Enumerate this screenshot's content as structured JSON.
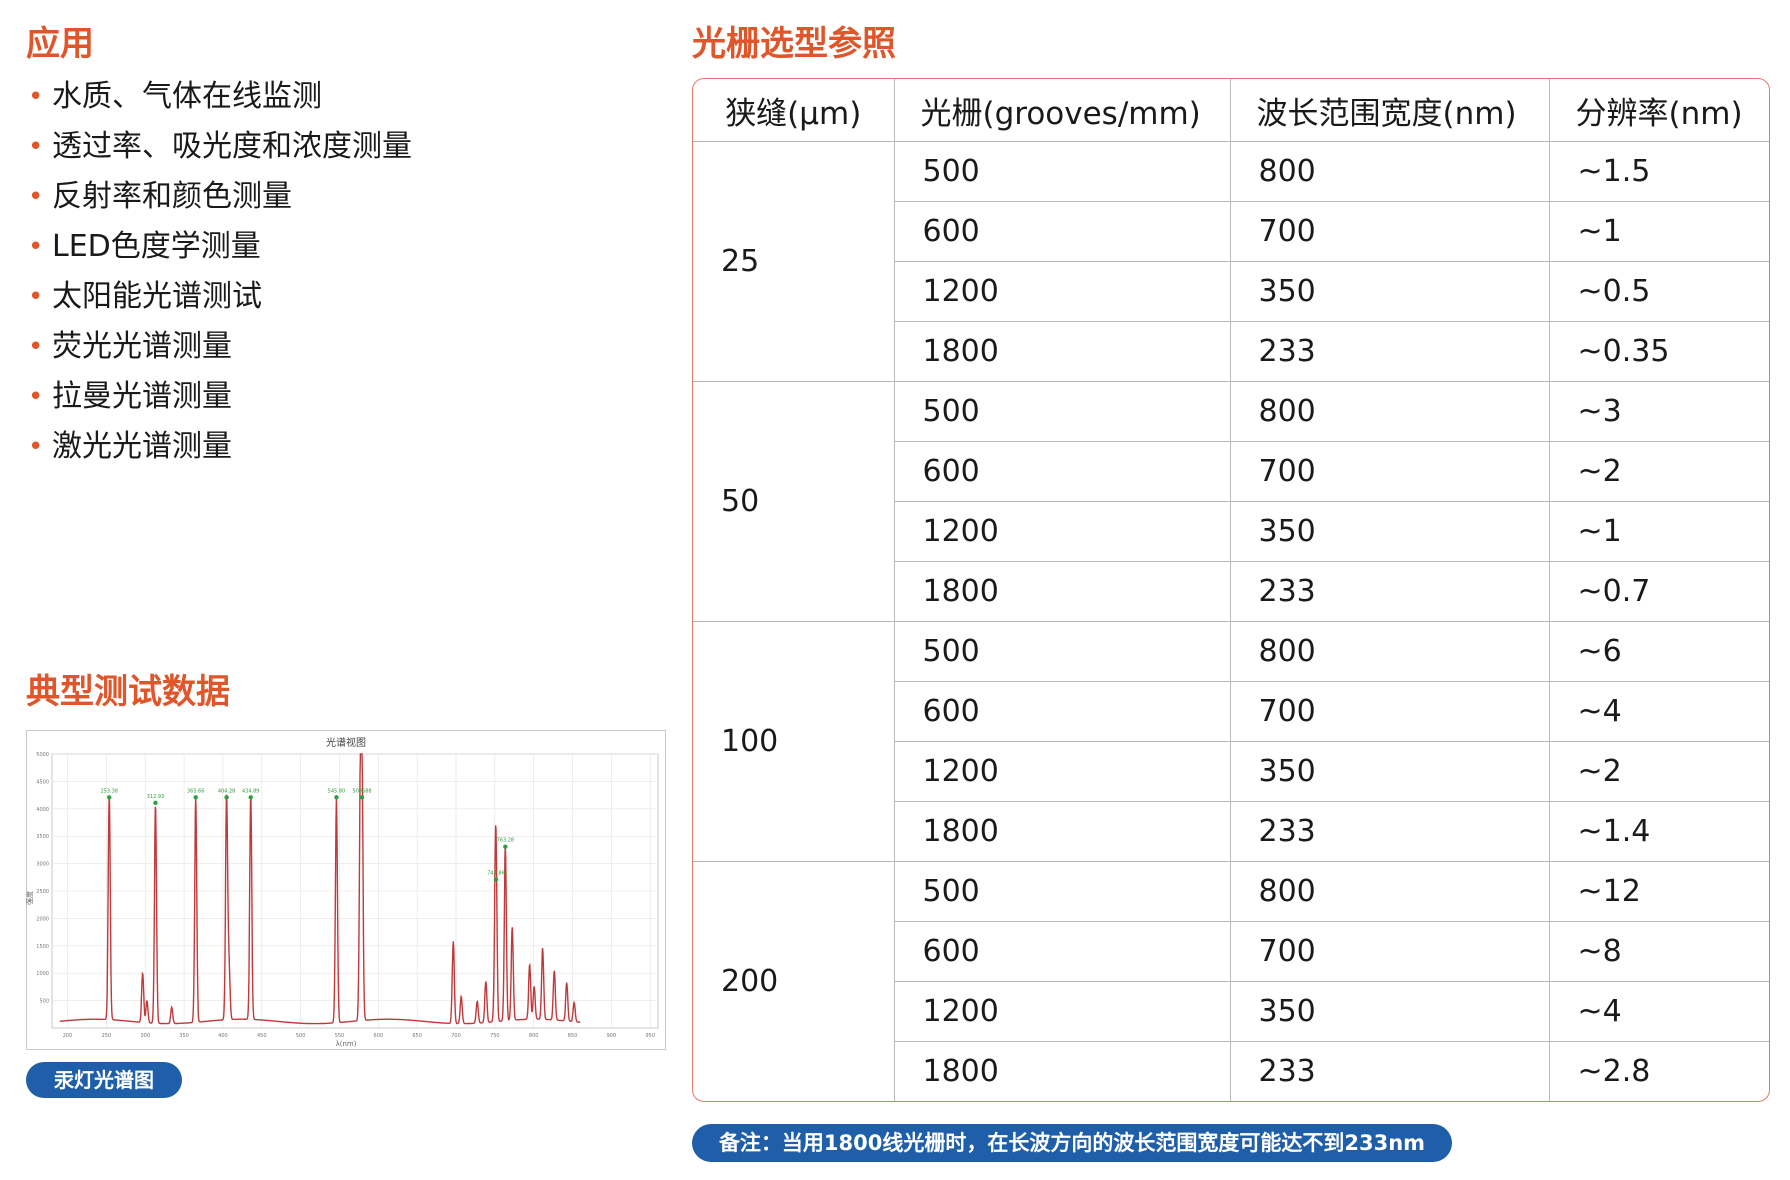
{
  "applications": {
    "title": "应用",
    "items": [
      "水质、气体在线监测",
      "透过率、吸光度和浓度测量",
      "反射率和颜色测量",
      "LED色度学测量",
      "太阳能光谱测试",
      "荧光光谱测量",
      "拉曼光谱测量",
      "激光光谱测量"
    ]
  },
  "typical": {
    "title": "典型测试数据",
    "caption": "汞灯光谱图"
  },
  "grating": {
    "title": "光栅选型参照",
    "headers": [
      "狭缝(μm)",
      "光栅(grooves/mm)",
      "波长范围宽度(nm)",
      "分辨率(nm)"
    ],
    "groups": [
      {
        "slit": "25",
        "rows": [
          [
            "500",
            "800",
            "~1.5"
          ],
          [
            "600",
            "700",
            "~1"
          ],
          [
            "1200",
            "350",
            "~0.5"
          ],
          [
            "1800",
            "233",
            "~0.35"
          ]
        ]
      },
      {
        "slit": "50",
        "rows": [
          [
            "500",
            "800",
            "~3"
          ],
          [
            "600",
            "700",
            "~2"
          ],
          [
            "1200",
            "350",
            "~1"
          ],
          [
            "1800",
            "233",
            "~0.7"
          ]
        ]
      },
      {
        "slit": "100",
        "rows": [
          [
            "500",
            "800",
            "~6"
          ],
          [
            "600",
            "700",
            "~4"
          ],
          [
            "1200",
            "350",
            "~2"
          ],
          [
            "1800",
            "233",
            "~1.4"
          ]
        ]
      },
      {
        "slit": "200",
        "rows": [
          [
            "500",
            "800",
            "~12"
          ],
          [
            "600",
            "700",
            "~8"
          ],
          [
            "1200",
            "350",
            "~4"
          ],
          [
            "1800",
            "233",
            "~2.8"
          ]
        ]
      }
    ],
    "note": "备注：当用1800线光栅时，在长波方向的波长范围宽度可能达不到233nm"
  },
  "colors": {
    "accent": "#e0562a",
    "pill": "#1f5ea8",
    "spectrum": "#c0393b",
    "peak_label": "#2e9e3e"
  },
  "chart_data": {
    "type": "line",
    "title": "光谱视图",
    "xlabel": "λ(nm)",
    "ylabel": "强度",
    "xlim": [
      180,
      960
    ],
    "ylim": [
      0,
      5000
    ],
    "xticks": [
      200,
      250,
      300,
      350,
      400,
      450,
      500,
      550,
      600,
      650,
      700,
      750,
      800,
      850,
      900,
      950
    ],
    "yticks": [
      500,
      1000,
      1500,
      2000,
      2500,
      3000,
      3500,
      4000,
      4500,
      5000
    ],
    "grid": true,
    "peaks": [
      {
        "x": 253.65,
        "y": 4100,
        "label": "253.38"
      },
      {
        "x": 296.7,
        "y": 900,
        "label": ""
      },
      {
        "x": 302.2,
        "y": 400,
        "label": ""
      },
      {
        "x": 313.2,
        "y": 4000,
        "label": "312.93"
      },
      {
        "x": 334.1,
        "y": 300,
        "label": ""
      },
      {
        "x": 365.0,
        "y": 4100,
        "label": "365.66"
      },
      {
        "x": 404.7,
        "y": 4100,
        "label": "404.28"
      },
      {
        "x": 407.8,
        "y": 1000,
        "label": ""
      },
      {
        "x": 435.8,
        "y": 4100,
        "label": "434.89"
      },
      {
        "x": 546.1,
        "y": 4100,
        "label": "545.80"
      },
      {
        "x": 576.9,
        "y": 4100,
        "label": ""
      },
      {
        "x": 579.1,
        "y": 4100,
        "label": "508688"
      },
      {
        "x": 696.5,
        "y": 1500,
        "label": ""
      },
      {
        "x": 706.7,
        "y": 500,
        "label": ""
      },
      {
        "x": 727.3,
        "y": 400,
        "label": ""
      },
      {
        "x": 738.4,
        "y": 750,
        "label": ""
      },
      {
        "x": 750.4,
        "y": 1300,
        "label": ""
      },
      {
        "x": 751.5,
        "y": 2600,
        "label": "743.86"
      },
      {
        "x": 763.5,
        "y": 3200,
        "label": "763.28"
      },
      {
        "x": 772.4,
        "y": 1700,
        "label": ""
      },
      {
        "x": 794.8,
        "y": 1000,
        "label": ""
      },
      {
        "x": 800.6,
        "y": 600,
        "label": ""
      },
      {
        "x": 811.5,
        "y": 1300,
        "label": ""
      },
      {
        "x": 826.5,
        "y": 900,
        "label": ""
      },
      {
        "x": 842.5,
        "y": 700,
        "label": ""
      },
      {
        "x": 852.1,
        "y": 350,
        "label": ""
      }
    ]
  }
}
